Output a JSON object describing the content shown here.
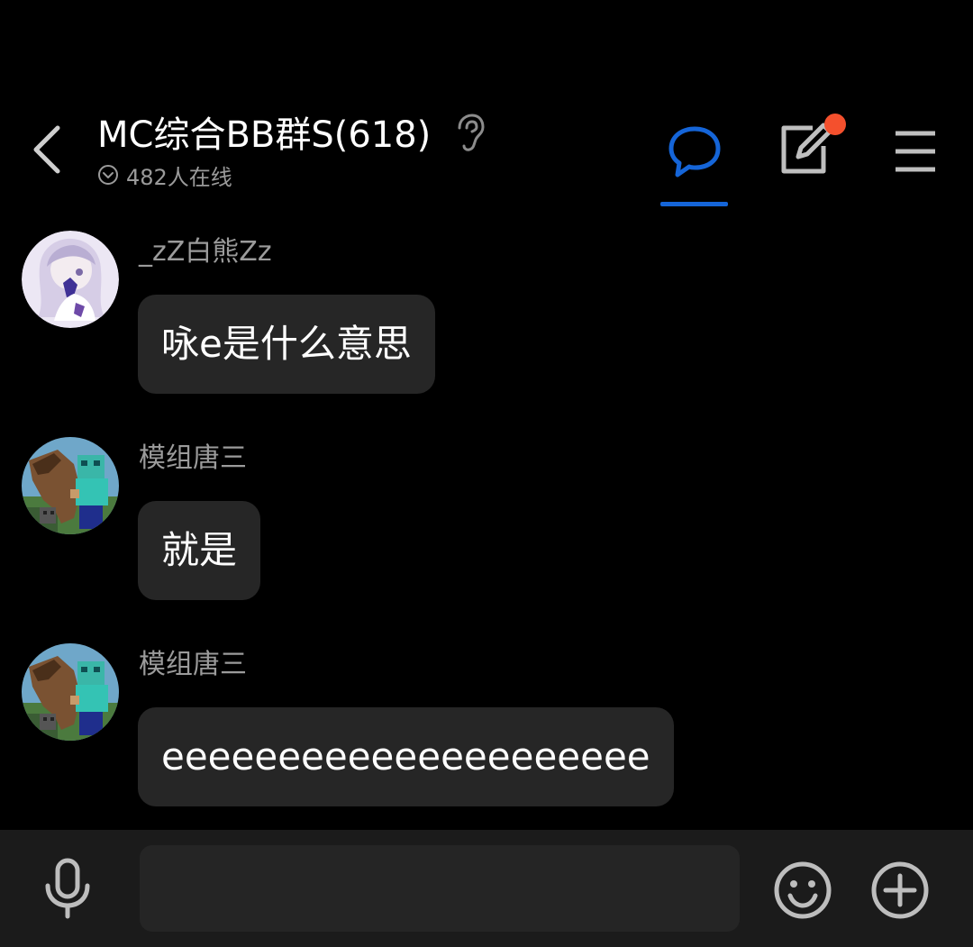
{
  "header": {
    "title": "MC综合BB群S(618)",
    "online_status": "482人在线",
    "icons": {
      "back": "back-arrow-icon",
      "ear": "ear-icon",
      "chat": "chat-bubble-icon",
      "compose": "compose-icon",
      "menu": "menu-icon"
    },
    "active_tab_color": "#1565d8",
    "notification_dot_color": "#f4502d"
  },
  "messages": [
    {
      "sender": "_zZ白熊Zz",
      "text": "咏e是什么意思",
      "avatar": "anime-girl-avatar"
    },
    {
      "sender": "模组唐三",
      "text": "就是",
      "avatar": "minecraft-avatar"
    },
    {
      "sender": "模组唐三",
      "text": "eeeeeeeeeeeeeeeeeeeee",
      "avatar": "minecraft-avatar"
    }
  ],
  "input_bar": {
    "placeholder": "",
    "icons": {
      "voice": "microphone-icon",
      "emoji": "smiley-icon",
      "add": "plus-circle-icon"
    }
  },
  "colors": {
    "background": "#000000",
    "bubble": "#262626",
    "input_bar": "#1b1b1b"
  }
}
